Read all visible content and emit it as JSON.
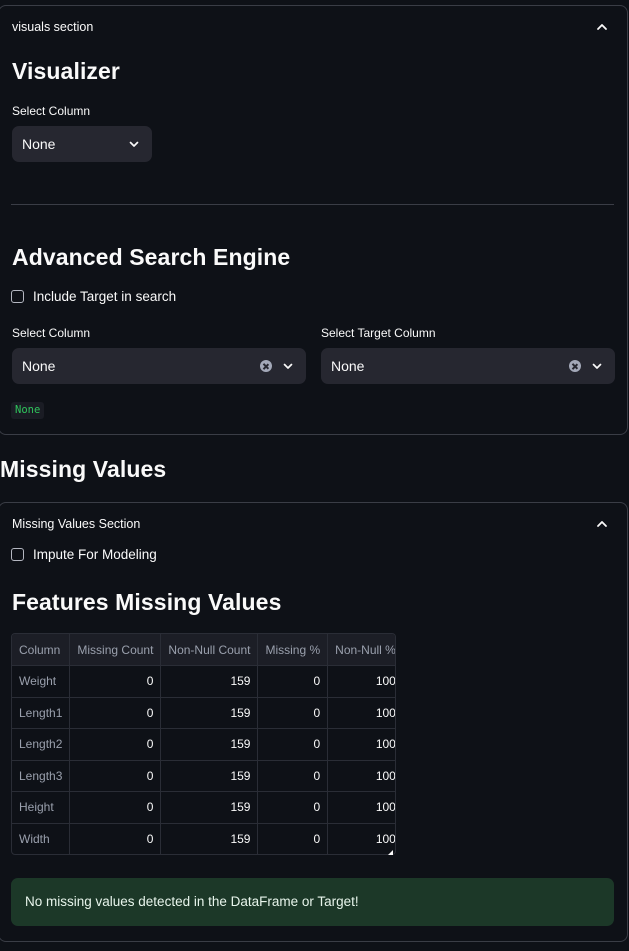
{
  "visuals_section": {
    "title": "visuals section",
    "visualizer": {
      "heading": "Visualizer",
      "select_label": "Select Column",
      "select_value": "None"
    },
    "search_engine": {
      "heading": "Advanced Search Engine",
      "include_target_label": "Include Target in search",
      "include_target_checked": false,
      "select_column_label": "Select Column",
      "select_column_value": "None",
      "select_target_label": "Select Target Column",
      "select_target_value": "None",
      "output_code": "None"
    }
  },
  "missing_values_heading": "Missing Values",
  "missing_section": {
    "title": "Missing Values Section",
    "impute_label": "Impute For Modeling",
    "impute_checked": false,
    "features_heading": "Features Missing Values",
    "table": {
      "columns": [
        "Column",
        "Missing Count",
        "Non-Null Count",
        "Missing %",
        "Non-Null %"
      ],
      "rows": [
        [
          "Weight",
          "0",
          "159",
          "0",
          "100"
        ],
        [
          "Length1",
          "0",
          "159",
          "0",
          "100"
        ],
        [
          "Length2",
          "0",
          "159",
          "0",
          "100"
        ],
        [
          "Length3",
          "0",
          "159",
          "0",
          "100"
        ],
        [
          "Height",
          "0",
          "159",
          "0",
          "100"
        ],
        [
          "Width",
          "0",
          "159",
          "0",
          "100"
        ]
      ]
    },
    "success_message": "No missing values detected in the DataFrame or Target!"
  },
  "icons": {
    "collapse": "chevron-up-icon",
    "dropdown": "chevron-down-icon",
    "clear": "clear-icon"
  },
  "colors": {
    "background": "#0e1117",
    "widget": "#262730",
    "code_text": "#2fc45c",
    "success_bg": "#1c3828"
  }
}
